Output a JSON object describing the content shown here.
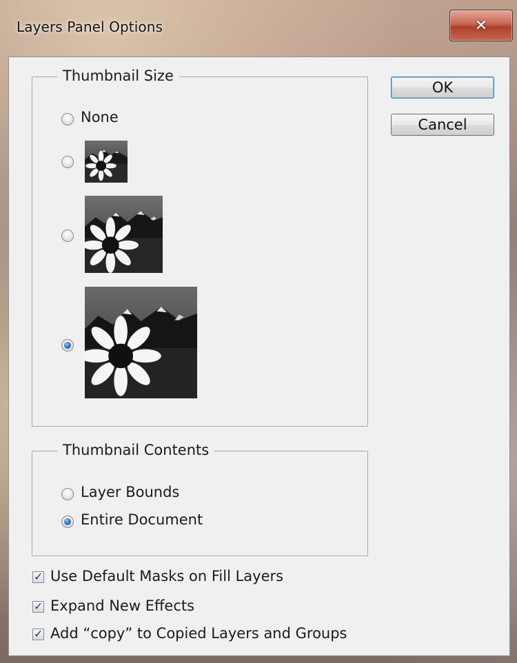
{
  "window": {
    "title": "Layers Panel Options",
    "close_icon": "close-icon"
  },
  "thumbnail_size": {
    "legend": "Thumbnail Size",
    "options": [
      {
        "label": "None",
        "selected": false
      },
      {
        "label": "",
        "size": "small",
        "selected": false
      },
      {
        "label": "",
        "size": "medium",
        "selected": false
      },
      {
        "label": "",
        "size": "large",
        "selected": true
      }
    ]
  },
  "thumbnail_contents": {
    "legend": "Thumbnail Contents",
    "options": [
      {
        "label": "Layer Bounds",
        "selected": false
      },
      {
        "label": "Entire Document",
        "selected": true
      }
    ]
  },
  "checkboxes": [
    {
      "label": "Use Default Masks on Fill Layers",
      "checked": true
    },
    {
      "label": "Expand New Effects",
      "checked": true
    },
    {
      "label": "Add “copy” to Copied Layers and Groups",
      "checked": true
    }
  ],
  "buttons": {
    "ok": "OK",
    "cancel": "Cancel"
  },
  "colors": {
    "dialog_bg": "#f0f0f0",
    "default_button_border": "#3c7fb1",
    "radio_selected": "#2a6fb7"
  }
}
